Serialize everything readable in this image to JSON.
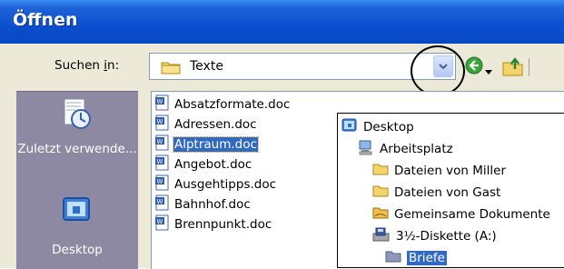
{
  "window": {
    "title": "Öffnen"
  },
  "toolbar": {
    "search_label": "Suchen in:",
    "current_folder": "Texte",
    "icons": [
      "folder-icon",
      "dropdown-arrow-icon",
      "back-icon",
      "up-folder-icon"
    ]
  },
  "places": [
    {
      "label": "Zuletzt verwende...",
      "icon": "recent-documents-icon"
    },
    {
      "label": "Desktop",
      "icon": "desktop-icon"
    }
  ],
  "files": [
    "Absatzformate.doc",
    "Adressen.doc",
    "Alptraum.doc",
    "Angebot.doc",
    "Ausgehtipps.doc",
    "Bahnhof.doc",
    "Brennpunkt.doc"
  ],
  "selected_file": "Alptraum.doc",
  "dropdown_items": [
    {
      "label": "Desktop",
      "icon": "desktop-icon"
    },
    {
      "label": "Arbeitsplatz",
      "icon": "computer-icon"
    },
    {
      "label": "Dateien von Miller",
      "icon": "folder-icon"
    },
    {
      "label": "Dateien von Gast",
      "icon": "folder-icon"
    },
    {
      "label": "Gemeinsame Dokumente",
      "icon": "shared-folder-icon"
    },
    {
      "label": "3½-Diskette (A:)",
      "icon": "floppy-drive-icon"
    },
    {
      "label": "Briefe",
      "icon": "folder-icon"
    }
  ],
  "selected_dropdown_item": "Briefe"
}
